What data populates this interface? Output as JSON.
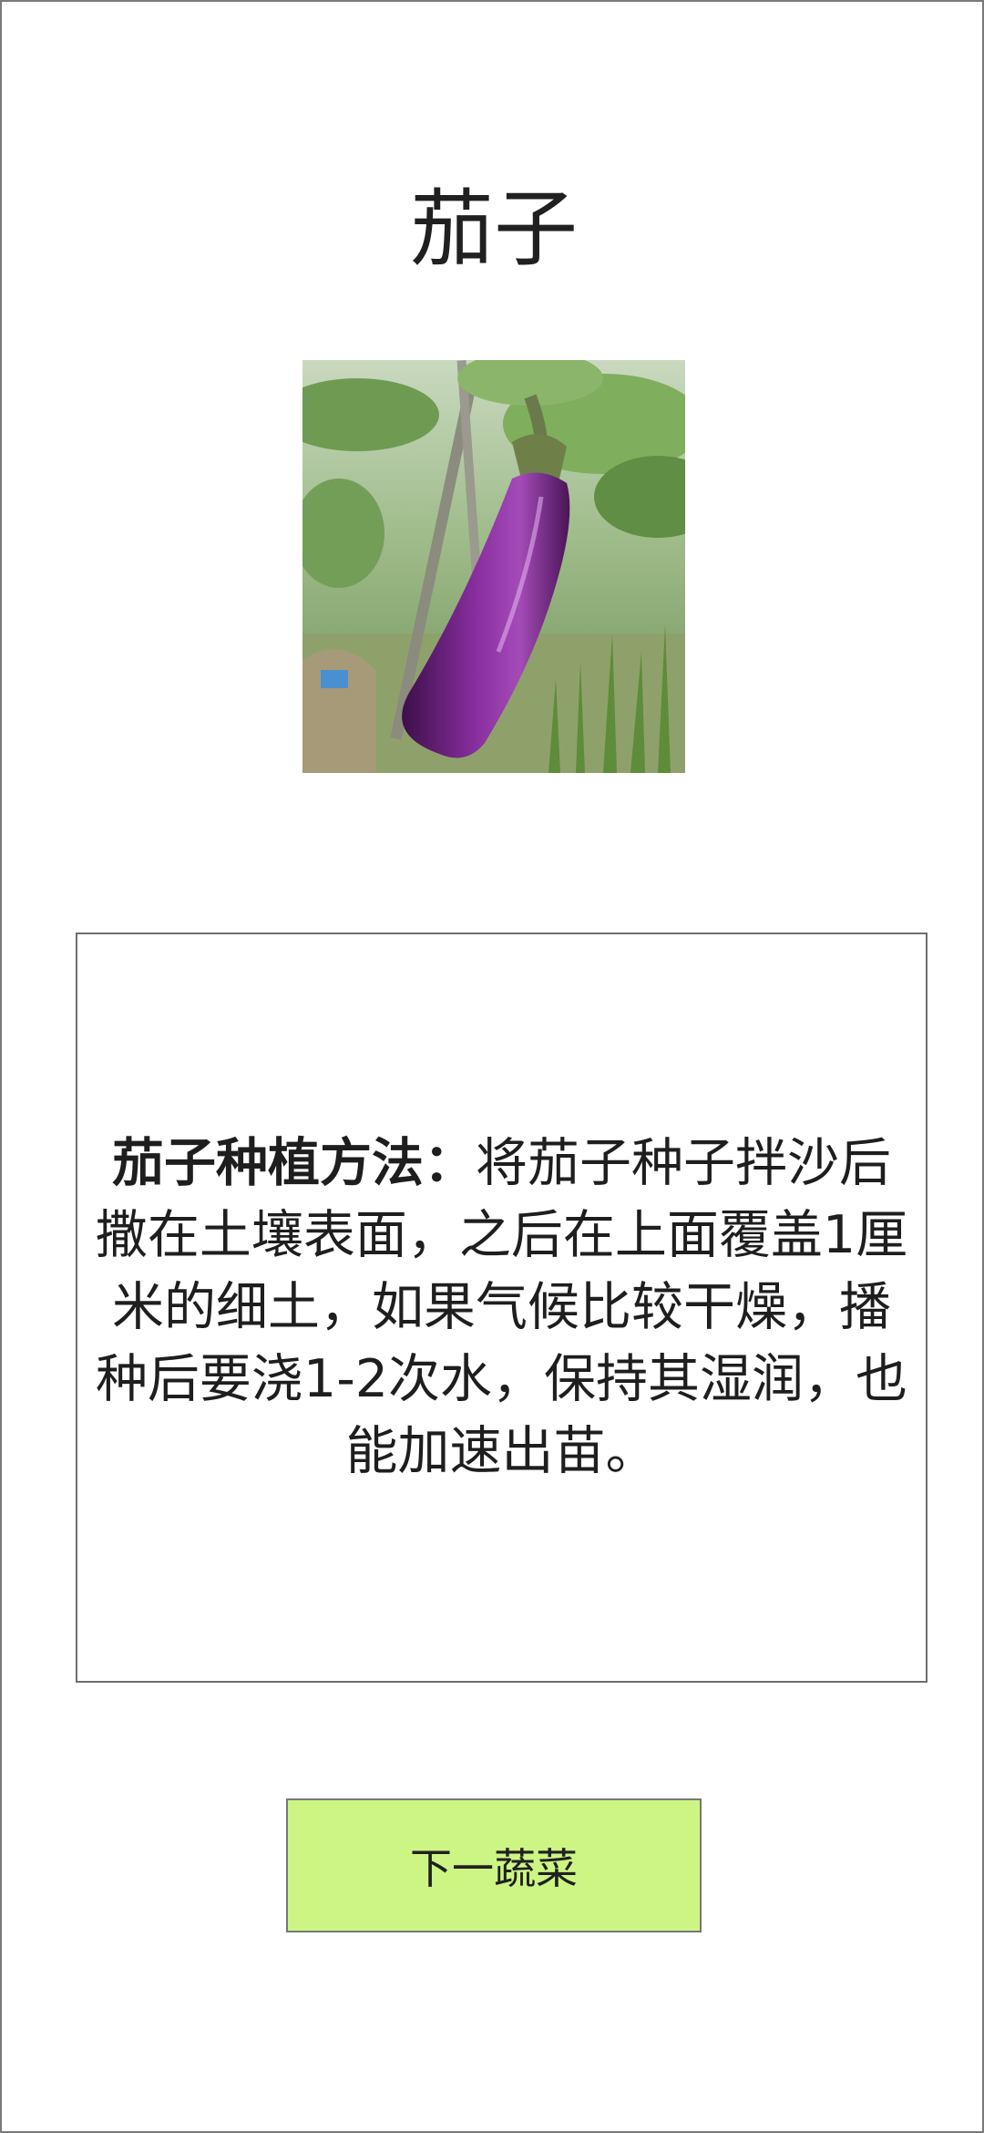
{
  "vegetable": {
    "name": "茄子",
    "image_subject": "eggplant"
  },
  "description": {
    "lead": "茄子种植方法：",
    "body": "将茄子种子拌沙后撒在土壤表面，之后在上面覆盖1厘米的细土，如果气候比较干燥，播种后要浇1-2次水，保持其湿润，也能加速出苗。"
  },
  "actions": {
    "next_label": "下一蔬菜"
  },
  "colors": {
    "button_bg": "#ccf584",
    "eggplant": "#6a1f7a",
    "foliage": "#7fa866"
  }
}
